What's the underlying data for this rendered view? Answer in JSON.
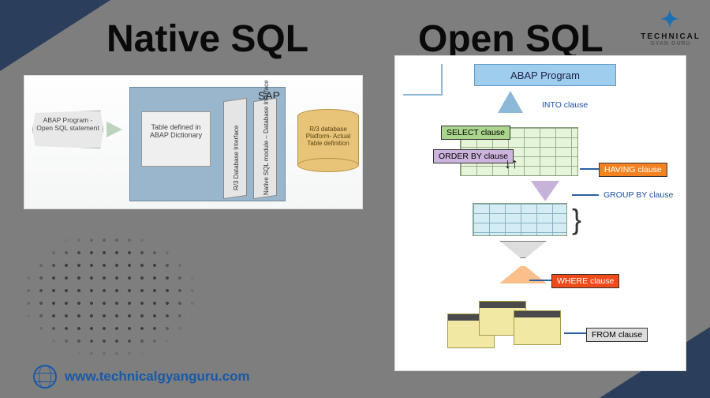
{
  "brand": {
    "name": "TECHNICAL",
    "sub": "GYAN GURU"
  },
  "headings": {
    "left": "Native SQL",
    "right": "Open SQL"
  },
  "native": {
    "abap_stmt": "ABAP Program - Open SQL statement",
    "sap": "SAP",
    "table_def": "Table defined in ABAP Dictionary",
    "r3_interface": "R/3 Database Interface",
    "native_module": "Native SQL module – Database Interface",
    "db": "R/3 database Platform- Actual Table definition"
  },
  "open": {
    "abap_program": "ABAP Program",
    "into": "INTO clause",
    "select": "SELECT clause",
    "orderby": "ORDER BY clause",
    "having": "HAVING clause",
    "groupby": "GROUP BY clause",
    "where": "WHERE clause",
    "from": "FROM clause"
  },
  "footer": {
    "url": "www.technicalgyanguru.com"
  }
}
